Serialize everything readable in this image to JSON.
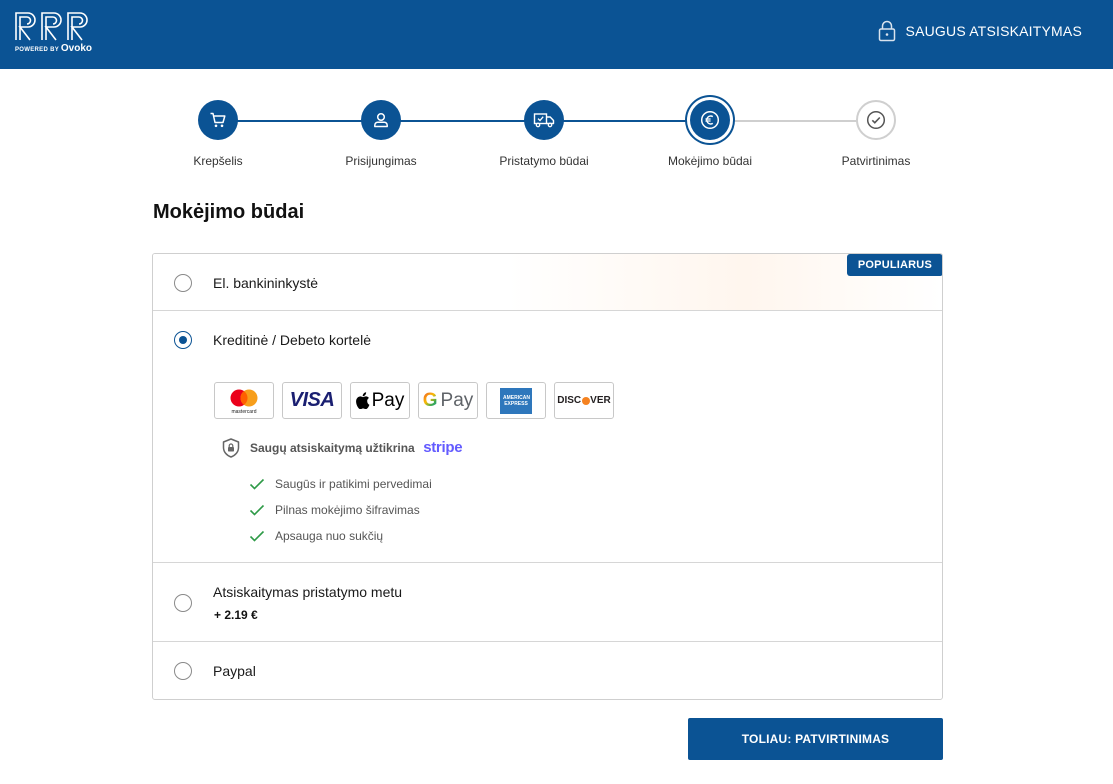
{
  "header": {
    "logo_powered_prefix": "POWERED BY",
    "logo_brand": "Ovoko",
    "secure_label": "SAUGUS ATSISKAITYMAS",
    "background": "#0b5394"
  },
  "stepper": {
    "steps": [
      {
        "label": "Krepšelis",
        "icon": "cart-icon",
        "state": "done"
      },
      {
        "label": "Prisijungimas",
        "icon": "user-icon",
        "state": "done"
      },
      {
        "label": "Pristatymo būdai",
        "icon": "truck-icon",
        "state": "done"
      },
      {
        "label": "Mokėjimo būdai",
        "icon": "euro-icon",
        "state": "active"
      },
      {
        "label": "Patvirtinimas",
        "icon": "check-circle-icon",
        "state": "pending"
      }
    ]
  },
  "page_title": "Mokėjimo būdai",
  "payment": {
    "options": [
      {
        "label": "El. bankininkystė",
        "selected": false,
        "badge": "POPULIARUS"
      },
      {
        "label": "Kreditinė / Debeto kortelė",
        "selected": true
      },
      {
        "label": "Atsiskaitymas pristatymo metu",
        "selected": false,
        "surcharge": "+ 2.19 €"
      },
      {
        "label": "Paypal",
        "selected": false
      }
    ],
    "cards": [
      {
        "name": "mastercard",
        "text": "mastercard"
      },
      {
        "name": "visa",
        "text": "VISA"
      },
      {
        "name": "apple-pay",
        "text": "Pay"
      },
      {
        "name": "google-pay",
        "text": "Pay"
      },
      {
        "name": "american-express",
        "text": "AMERICAN EXPRESS"
      },
      {
        "name": "discover",
        "text_left": "DISC",
        "text_right": "VER"
      }
    ],
    "stripe_text": "Saugų atsiskaitymą užtikrina",
    "stripe_brand": "stripe",
    "features": [
      "Saugūs ir patikimi pervedimai",
      "Pilnas mokėjimo šifravimas",
      "Apsauga nuo sukčių"
    ]
  },
  "next_button": "TOLIAU: PATVIRTINIMAS",
  "colors": {
    "primary": "#0b5394",
    "stripe": "#635bff",
    "check": "#2e9a47"
  }
}
